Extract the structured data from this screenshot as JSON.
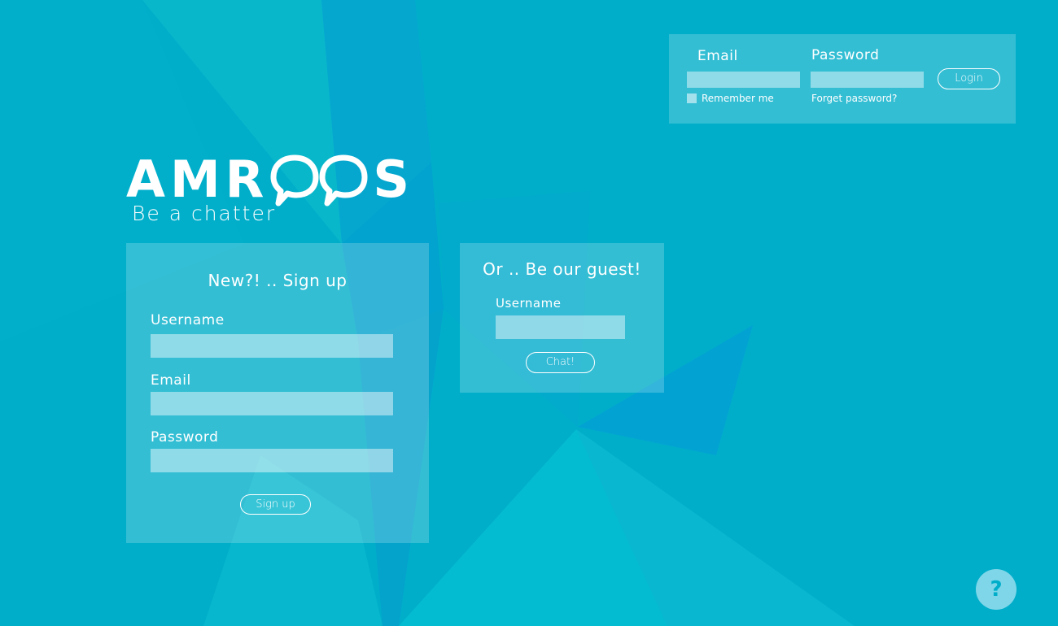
{
  "brand": {
    "name_prefix": "AMR",
    "name_suffix": "S",
    "tagline": "Be a chatter"
  },
  "login": {
    "email_label": "Email",
    "password_label": "Password",
    "email_value": "",
    "password_value": "",
    "button_label": "Login",
    "remember_label": "Remember me",
    "forgot_label": "Forget password?"
  },
  "signup": {
    "title": "New?! .. Sign up",
    "username_label": "Username",
    "email_label": "Email",
    "password_label": "Password",
    "username_value": "",
    "email_value": "",
    "password_value": "",
    "button_label": "Sign up"
  },
  "guest": {
    "title": "Or .. Be our guest!",
    "username_label": "Username",
    "username_value": "",
    "button_label": "Chat!"
  },
  "help": {
    "label": "?"
  },
  "colors": {
    "background": "#00aeca",
    "panel": "rgba(255,255,255,0.2)",
    "field": "rgba(255,255,255,0.45)",
    "text": "#ffffff"
  }
}
